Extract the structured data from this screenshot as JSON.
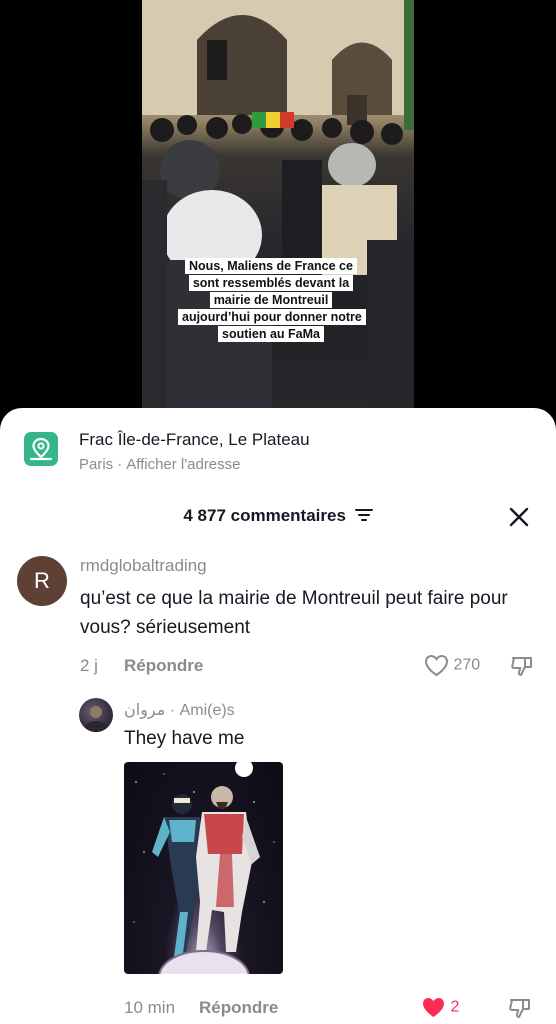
{
  "video": {
    "caption": "Nous, Maliens de France ce sont ressemblés devant la mairie de Montreuil aujourd’hui pour donner notre soutien au FaMa"
  },
  "location": {
    "icon": "map-pin-icon",
    "title": "Frac Île-de-France, Le Plateau",
    "city": "Paris",
    "separator": "·",
    "address_link": "Afficher l'adresse"
  },
  "comments_panel": {
    "count_label": "4 877 commentaires",
    "filter_icon": "sort-filter-icon",
    "close_icon": "close-icon"
  },
  "comments": [
    {
      "avatar_letter": "R",
      "avatar_color": "#5e4034",
      "username": "rmdglobaltrading",
      "text": "qu’est ce que la mairie de Montreuil peut faire pour vous? sérieusement",
      "time": "2 j",
      "reply_label": "Répondre",
      "likes": "270",
      "liked": false
    }
  ],
  "reply": {
    "username": "مروان",
    "separator": "·",
    "badge": "Ami(e)s",
    "text": "They have me",
    "image_icon": "comic-image",
    "time": "10 min",
    "reply_label": "Répondre",
    "likes": "2",
    "liked": true,
    "like_color": "#fe2c55"
  }
}
